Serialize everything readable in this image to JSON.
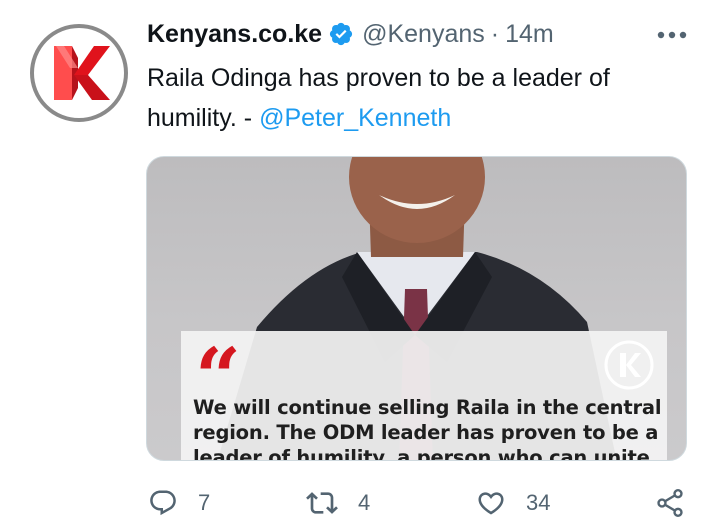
{
  "tweet": {
    "author_name": "Kenyans.co.ke",
    "handle": "@Kenyans",
    "separator": "·",
    "time": "14m",
    "text": "Raila Odinga has proven to be a leader of humility. - ",
    "mention": "@Peter_Kenneth"
  },
  "media": {
    "quote_mark": "“",
    "quote_text": "We will continue selling Raila in the central region. The ODM leader has proven to be a leader of humility, a person who can unite"
  },
  "actions": {
    "replies": "7",
    "retweets": "4",
    "likes": "34"
  },
  "icons": {
    "avatar": "kenyans-logo-icon",
    "verified": "verified-badge-icon",
    "more": "more-icon",
    "reply": "reply-icon",
    "retweet": "retweet-icon",
    "like": "like-icon",
    "share": "share-icon"
  },
  "colors": {
    "brand_red": "#d5171f",
    "link_blue": "#1d9bf0",
    "secondary_text": "#536471"
  }
}
